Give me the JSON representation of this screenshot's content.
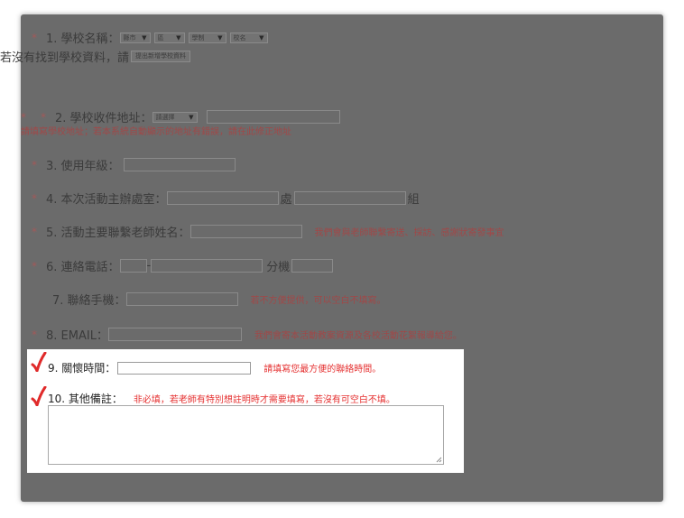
{
  "form": {
    "q1": {
      "label": "1. 學校名稱：",
      "selects": [
        "縣市",
        "區",
        "學制",
        "校名"
      ],
      "not_found_text": "若沒有找到學校資料，請",
      "propose_button": "提出新增學校資料"
    },
    "q2": {
      "label": "2. 學校收件地址：",
      "select": "請選擇",
      "hint": "請填寫學校地址；若本系統自動顯示的地址有錯誤，請在此修正地址"
    },
    "q3": {
      "label": "3. 使用年級："
    },
    "q4": {
      "label": "4. 本次活動主辦處室：",
      "unit_office": "處",
      "unit_group": "組"
    },
    "q5": {
      "label": "5. 活動主要聯繫老師姓名：",
      "hint": "我們會與老師聯繫寄送、採訪、感謝狀寄發事宜"
    },
    "q6": {
      "label": "6. 連絡電話：",
      "dash": "-",
      "ext": "分機"
    },
    "q7": {
      "label": "7. 聯絡手機：",
      "hint": "若不方便提供，可以空白不填寫。"
    },
    "q8": {
      "label": "8. EMAIL：",
      "hint": "我們會寄本活動教案資源及各校活動花絮報導給您。"
    },
    "required_mark": "*",
    "q9": {
      "label": "9. 關懷時間：",
      "hint": "請填寫您最方便的聯絡時間。"
    },
    "q10": {
      "label": "10. 其他備註：",
      "hint": "非必填，若老師有特別想註明時才需要填寫，若沒有可空白不填。"
    }
  }
}
